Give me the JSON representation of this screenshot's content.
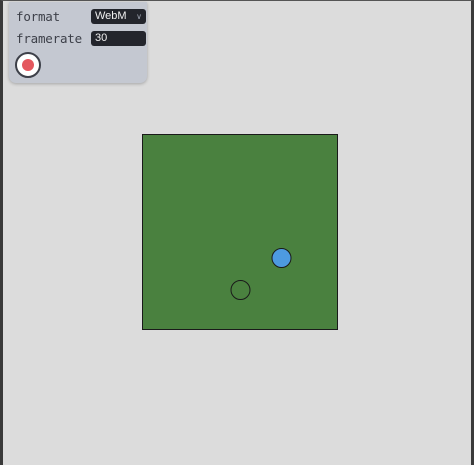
{
  "controls": {
    "format_label": "format",
    "format_value": "WebM",
    "framerate_label": "framerate",
    "framerate_value": "30",
    "record_icon": "record-icon",
    "record_color": "#e4575e"
  },
  "canvas": {
    "field_color": "#4a813f",
    "player_color": "#4d9ae0",
    "target_color": "#4a813f"
  }
}
